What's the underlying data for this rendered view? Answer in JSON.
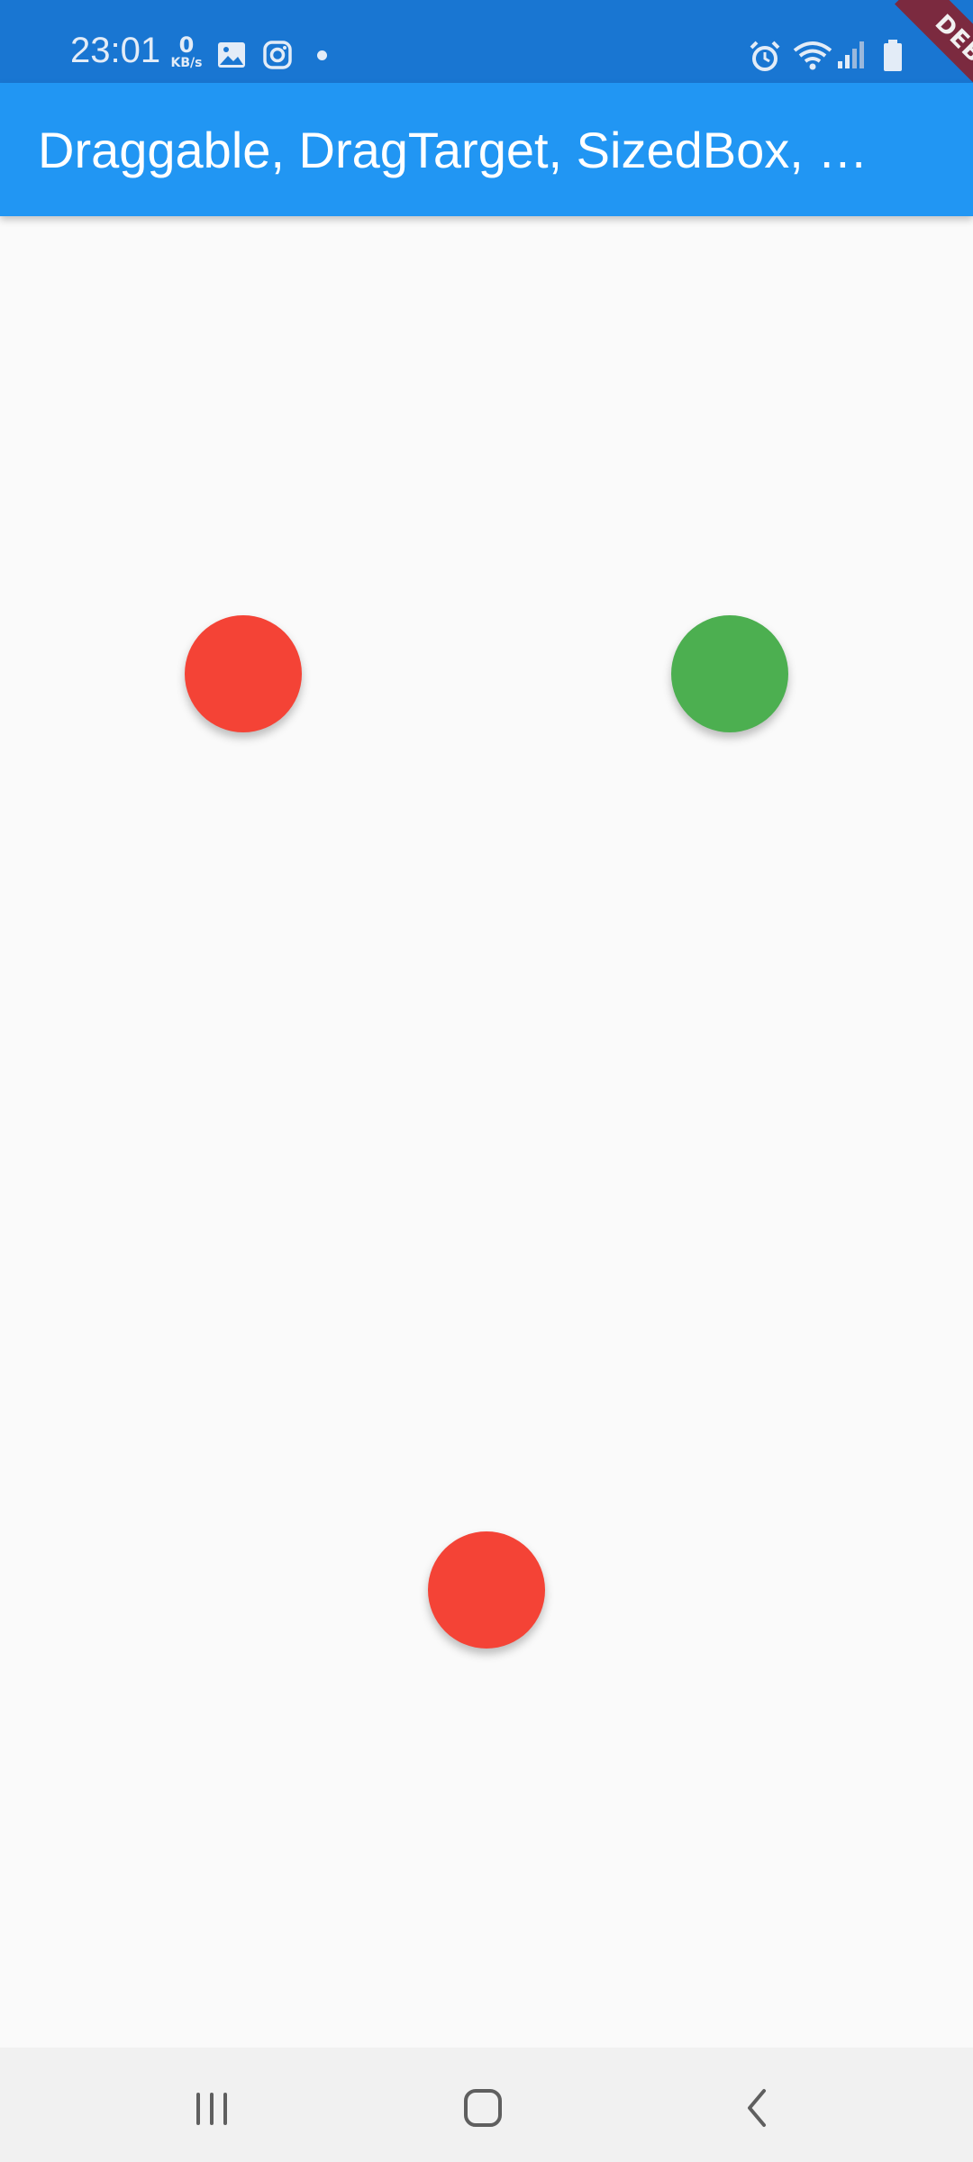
{
  "status_bar": {
    "time": "23:01",
    "network_speed_value": "0",
    "network_speed_unit": "KB/s",
    "icons": [
      "gallery-icon",
      "instagram-icon",
      "notification-dot-icon",
      "alarm-icon",
      "wifi-icon",
      "cellular-signal-icon",
      "battery-icon"
    ]
  },
  "debug_banner": {
    "label": "DEBUG",
    "color": "#7b2a3f"
  },
  "app_bar": {
    "title": "Draggable, DragTarget, SizedBox, …",
    "color": "#2196f3"
  },
  "canvas": {
    "items": [
      {
        "name": "red-draggable-circle-left",
        "color": "#f44336"
      },
      {
        "name": "green-drag-target-circle",
        "color": "#4caf50"
      },
      {
        "name": "red-draggable-circle-bottom",
        "color": "#f44336"
      }
    ]
  },
  "nav_bar": {
    "buttons": [
      "recent-apps-icon",
      "home-icon",
      "back-icon"
    ]
  }
}
